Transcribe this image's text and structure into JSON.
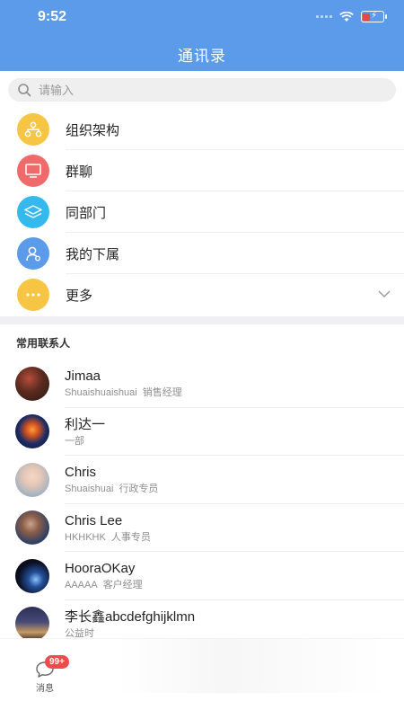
{
  "status_bar": {
    "time": "9:52"
  },
  "header": {
    "title": "通讯录"
  },
  "search": {
    "placeholder": "请输入"
  },
  "menu": [
    {
      "label": "组织架构",
      "icon": "org-chart-icon",
      "color": "#f6c543"
    },
    {
      "label": "群聊",
      "icon": "group-chat-icon",
      "color": "#ef6a6a"
    },
    {
      "label": "同部门",
      "icon": "layers-icon",
      "color": "#33b9ee"
    },
    {
      "label": "我的下属",
      "icon": "subordinate-icon",
      "color": "#5b9bea"
    },
    {
      "label": "更多",
      "icon": "more-icon",
      "color": "#f6c543"
    }
  ],
  "contacts_section": {
    "title": "常用联系人"
  },
  "contacts": [
    {
      "name": "Jimaa",
      "sub1": "Shuaishuaishuai",
      "sub2": "销售经理"
    },
    {
      "name": "利达一",
      "sub1": "一部",
      "sub2": ""
    },
    {
      "name": "Chris",
      "sub1": "Shuaishuai",
      "sub2": "行政专员"
    },
    {
      "name": "Chris Lee",
      "sub1": "HKHKHK",
      "sub2": "人事专员"
    },
    {
      "name": "HooraOKay",
      "sub1": "AAAAA",
      "sub2": "客户经理"
    },
    {
      "name": "李长鑫abcdefghijklmn",
      "sub1": "公益时",
      "sub2": ""
    }
  ],
  "tabbar": {
    "messages_label": "消息",
    "badge": "99+"
  },
  "colors": {
    "header": "#5b9bea",
    "badge": "#f14a4a"
  }
}
